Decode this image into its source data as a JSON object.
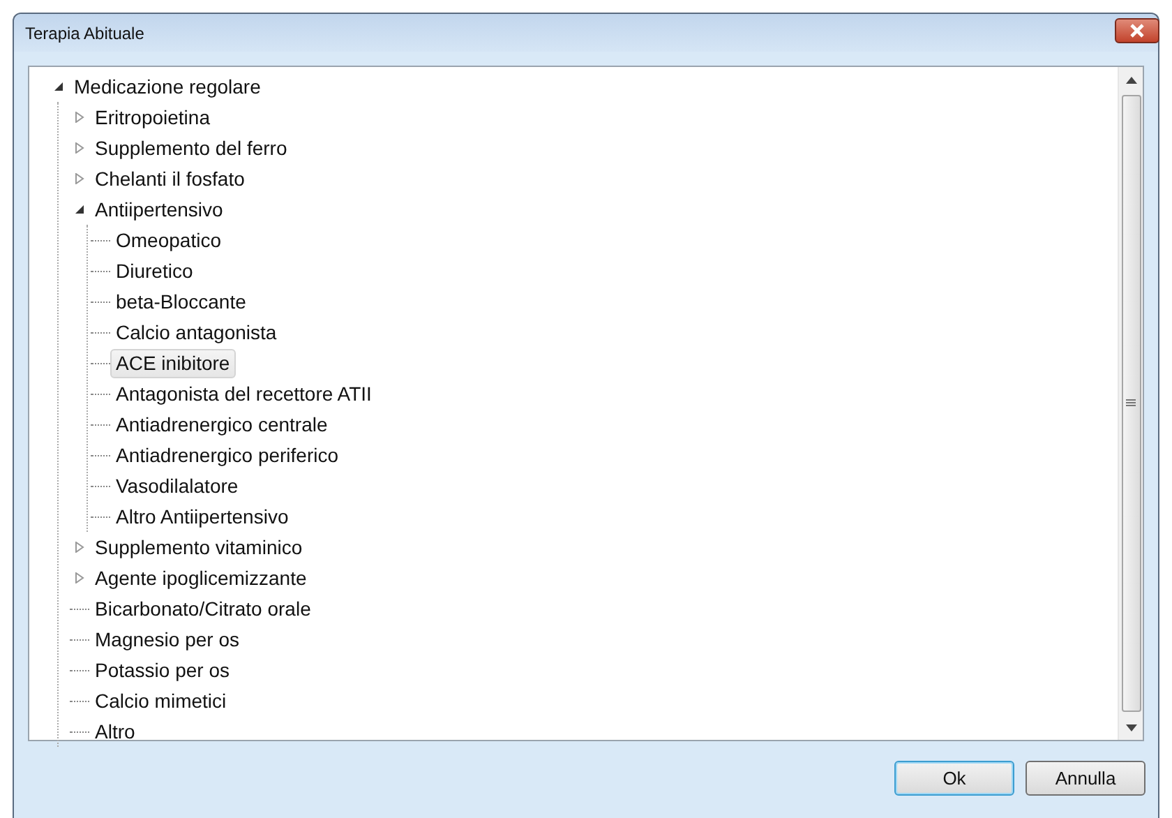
{
  "window": {
    "title": "Terapia Abituale"
  },
  "tree": [
    {
      "label": "Medicazione regolare",
      "expanded": true,
      "selected": false,
      "children": [
        {
          "label": "Eritropoietina",
          "expanded": false,
          "selected": false
        },
        {
          "label": "Supplemento del ferro",
          "expanded": false,
          "selected": false
        },
        {
          "label": "Chelanti il fosfato",
          "expanded": false,
          "selected": false
        },
        {
          "label": "Antiipertensivo",
          "expanded": true,
          "selected": false,
          "children": [
            {
              "label": "Omeopatico",
              "selected": false
            },
            {
              "label": "Diuretico",
              "selected": false
            },
            {
              "label": "beta-Bloccante",
              "selected": false
            },
            {
              "label": "Calcio antagonista",
              "selected": false
            },
            {
              "label": "ACE inibitore",
              "selected": true
            },
            {
              "label": "Antagonista del recettore ATII",
              "selected": false
            },
            {
              "label": "Antiadrenergico centrale",
              "selected": false
            },
            {
              "label": "Antiadrenergico periferico",
              "selected": false
            },
            {
              "label": "Vasodilalatore",
              "selected": false
            },
            {
              "label": "Altro Antiipertensivo",
              "selected": false
            }
          ]
        },
        {
          "label": "Supplemento vitaminico",
          "expanded": false,
          "selected": false
        },
        {
          "label": "Agente ipoglicemizzante",
          "expanded": false,
          "selected": false
        },
        {
          "label": "Bicarbonato/Citrato orale",
          "selected": false
        },
        {
          "label": "Magnesio per os",
          "selected": false
        },
        {
          "label": "Potassio per os",
          "selected": false
        },
        {
          "label": "Calcio mimetici",
          "selected": false
        },
        {
          "label": "Altro",
          "selected": false
        }
      ]
    }
  ],
  "buttons": [
    {
      "label": "Ok",
      "default": true
    },
    {
      "label": "Annulla",
      "default": false
    }
  ]
}
